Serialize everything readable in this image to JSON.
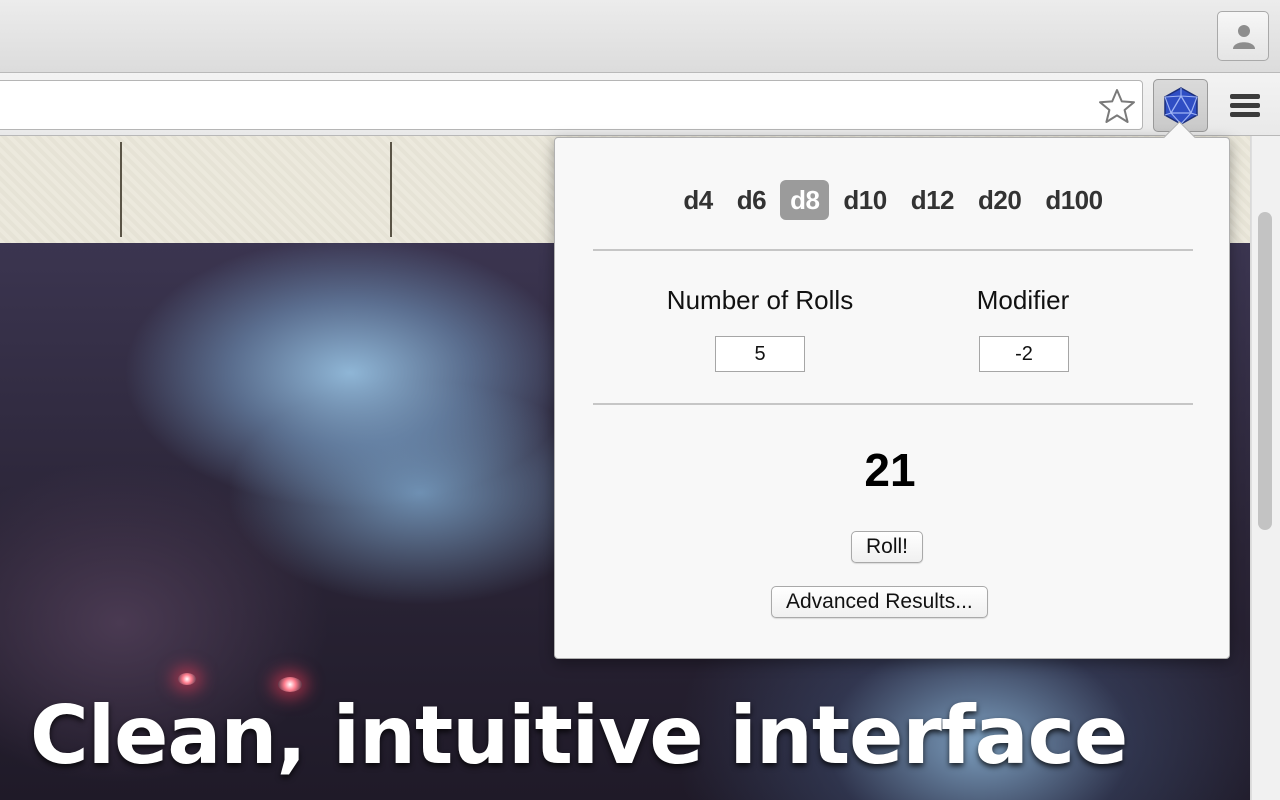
{
  "browser": {
    "profile_icon": "person-icon",
    "bookmark_icon": "star-icon",
    "extension_icon": "d20-icon",
    "menu_icon": "hamburger-menu-icon",
    "address_value": ""
  },
  "popup": {
    "dice": [
      {
        "label": "d4",
        "selected": false
      },
      {
        "label": "d6",
        "selected": false
      },
      {
        "label": "d8",
        "selected": true
      },
      {
        "label": "d10",
        "selected": false
      },
      {
        "label": "d12",
        "selected": false
      },
      {
        "label": "d20",
        "selected": false
      },
      {
        "label": "d100",
        "selected": false
      }
    ],
    "rolls_label": "Number of Rolls",
    "rolls_value": "5",
    "modifier_label": "Modifier",
    "modifier_value": "-2",
    "result": "21",
    "roll_button": "Roll!",
    "advanced_button": "Advanced Results..."
  },
  "hero": {
    "tagline": "Clean, intuitive interface"
  },
  "colors": {
    "selected_tab": "#9b9b9b",
    "d20_icon_fill": "#2f4ec4"
  }
}
